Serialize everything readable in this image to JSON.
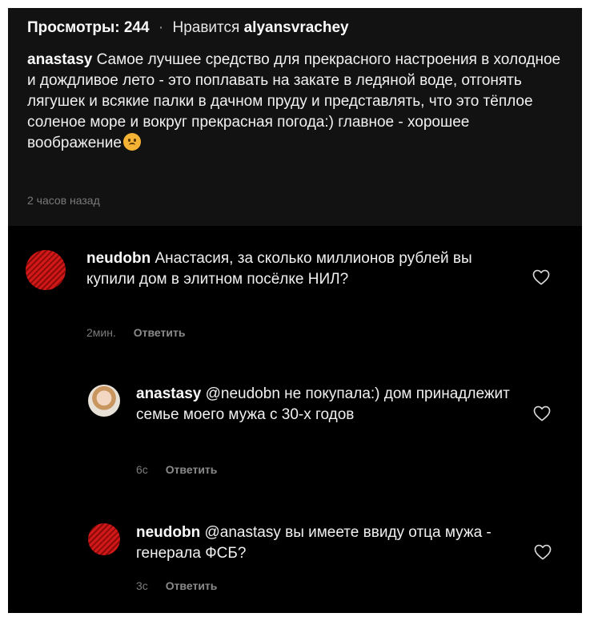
{
  "post": {
    "views_label": "Просмотры: 244",
    "separator": "·",
    "likes_prefix": "Нравится",
    "liked_by": "alyansvrachey",
    "author": "anastasy",
    "caption": "Самое лучшее средство для прекрасного настроения в холодное и дождливое лето - это поплавать на закате в ледяной воде, отгонять лягушек и всякие палки в дачном пруду и представлять, что это тёплое соленое море и вокруг прекрасная погода:) главное - хорошее воображение",
    "emoji": "upside-down-face-emoji",
    "time": "2 часов назад"
  },
  "comments": [
    {
      "username": "neudobn",
      "text": "Анастасия, за сколько миллионов рублей вы купили дом в элитном посёлке НИЛ?",
      "time": "2мин.",
      "reply_label": "Ответить",
      "avatar": "red-avatar"
    },
    {
      "username": "anastasy",
      "text": "@neudobn не покупала:) дом принадлежит семье моего мужа с 30-х годов",
      "time": "6с",
      "reply_label": "Ответить",
      "avatar": "photo-avatar"
    },
    {
      "username": "neudobn",
      "text": "@anastasy вы имеете ввиду отца мужа - генерала ФСБ?",
      "time": "3с",
      "reply_label": "Ответить",
      "avatar": "red-avatar"
    }
  ],
  "icons": {
    "like": "heart-outline-icon"
  },
  "colors": {
    "background": "#000000",
    "post_background": "#121212",
    "avatar_red": "#d01818"
  }
}
